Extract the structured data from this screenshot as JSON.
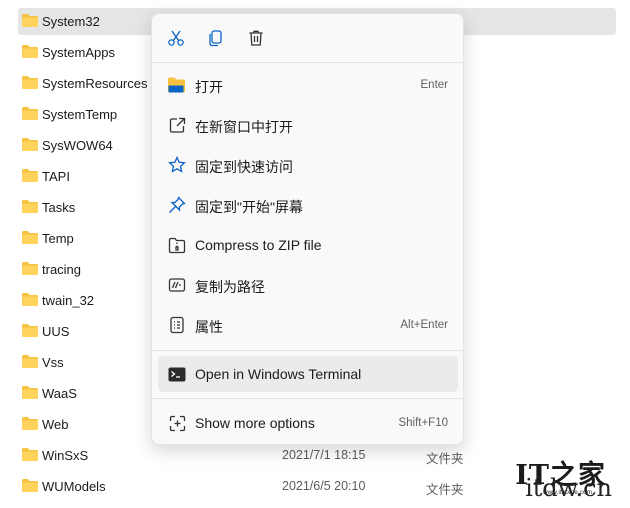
{
  "files": [
    {
      "name": "System32",
      "date": "",
      "type": "",
      "selected": true
    },
    {
      "name": "SystemApps",
      "date": "",
      "type": ""
    },
    {
      "name": "SystemResources",
      "date": "",
      "type": ""
    },
    {
      "name": "SystemTemp",
      "date": "",
      "type": ""
    },
    {
      "name": "SysWOW64",
      "date": "",
      "type": ""
    },
    {
      "name": "TAPI",
      "date": "",
      "type": ""
    },
    {
      "name": "Tasks",
      "date": "",
      "type": ""
    },
    {
      "name": "Temp",
      "date": "",
      "type": ""
    },
    {
      "name": "tracing",
      "date": "",
      "type": ""
    },
    {
      "name": "twain_32",
      "date": "",
      "type": ""
    },
    {
      "name": "UUS",
      "date": "",
      "type": ""
    },
    {
      "name": "Vss",
      "date": "",
      "type": ""
    },
    {
      "name": "WaaS",
      "date": "",
      "type": ""
    },
    {
      "name": "Web",
      "date": "",
      "type": ""
    },
    {
      "name": "WinSxS",
      "date": "2021/7/1 18:15",
      "type": "文件夹"
    },
    {
      "name": "WUModels",
      "date": "2021/6/5 20:10",
      "type": "文件夹"
    }
  ],
  "context_menu": {
    "quick_actions": [
      {
        "icon": "cut-icon"
      },
      {
        "icon": "copy-icon"
      },
      {
        "icon": "delete-icon"
      }
    ],
    "items": [
      {
        "label": "打开",
        "shortcut": "Enter",
        "icon": "open-folder-icon"
      },
      {
        "label": "在新窗口中打开",
        "shortcut": "",
        "icon": "open-new-window-icon"
      },
      {
        "label": "固定到快速访问",
        "shortcut": "",
        "icon": "star-icon"
      },
      {
        "label": "固定到\"开始\"屏幕",
        "shortcut": "",
        "icon": "pin-icon"
      },
      {
        "label": "Compress to ZIP file",
        "shortcut": "",
        "icon": "zip-icon"
      },
      {
        "label": "复制为路径",
        "shortcut": "",
        "icon": "copy-path-icon"
      },
      {
        "label": "属性",
        "shortcut": "Alt+Enter",
        "icon": "properties-icon"
      },
      {
        "label": "Open in Windows Terminal",
        "shortcut": "",
        "icon": "terminal-icon",
        "highlighted": true
      },
      {
        "label": "Show more options",
        "shortcut": "Shift+F10",
        "icon": "more-options-icon"
      }
    ]
  },
  "watermark": {
    "logo": "IT之家",
    "text": "itdw.cn",
    "url": "www.ithome.com"
  },
  "colors": {
    "folder": "#f5c242",
    "icon_blue": "#0a64c8",
    "selected_row": "#e5e5e5",
    "menu_bg": "#f9f9f9",
    "menu_highlight": "#ebebeb"
  }
}
